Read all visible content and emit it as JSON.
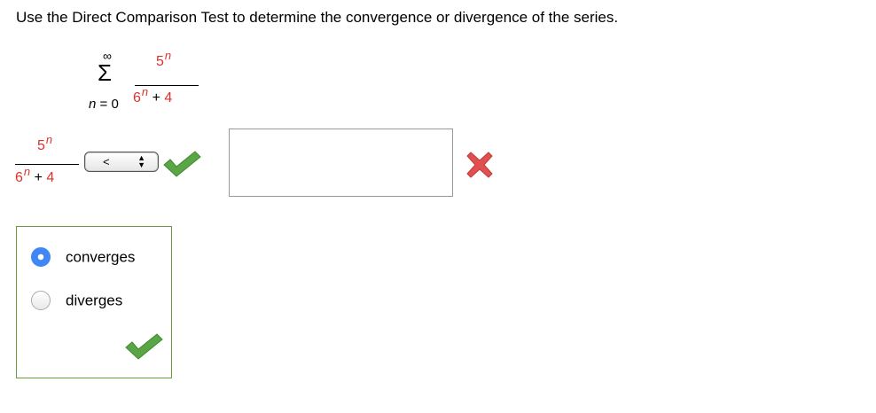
{
  "prompt": "Use the Direct Comparison Test to determine the convergence or divergence of the series.",
  "series": {
    "upper_limit": "∞",
    "sigma": "Σ",
    "index_var": "n",
    "index_eq": " = 0",
    "numerator_base": "5",
    "denominator_base": "6",
    "exponent": "n",
    "denominator_tail": " + 4"
  },
  "term": {
    "numerator_base": "5",
    "denominator_base": "6",
    "exponent": "n",
    "denominator_tail": " + 4"
  },
  "comparison_select": {
    "selected": "<",
    "status_icon": "check-icon"
  },
  "comparison_answer": {
    "value": "",
    "status_icon": "x-icon"
  },
  "options": {
    "items": [
      {
        "label": "converges",
        "selected": true
      },
      {
        "label": "diverges",
        "selected": false
      }
    ],
    "status_icon": "check-icon"
  },
  "colors": {
    "accent_red": "#e0302a",
    "radio_blue": "#3f87f5",
    "check_green": "#5aa545",
    "x_red": "#e05050",
    "frame_green": "#6a9a3a"
  }
}
